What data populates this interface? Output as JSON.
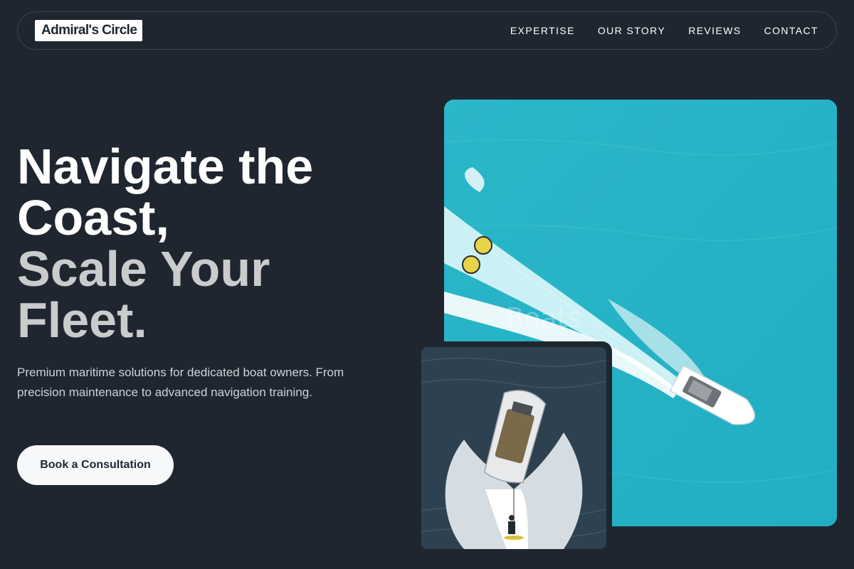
{
  "brand": {
    "logo_text": "Admiral's Circle"
  },
  "nav": {
    "items": [
      {
        "label": "EXPERTISE"
      },
      {
        "label": "OUR STORY"
      },
      {
        "label": "REVIEWS"
      },
      {
        "label": "CONTACT"
      }
    ]
  },
  "hero": {
    "headline_line1": "Navigate the Coast,",
    "headline_line2": "Scale Your Fleet.",
    "subtext": "Premium maritime solutions for dedicated boat owners. From precision maintenance to advanced navigation training.",
    "cta_label": "Book a Consultation",
    "watermark": "Boats"
  },
  "colors": {
    "background": "#1f2630",
    "sea_turquoise": "#28b6c9",
    "sea_dark": "#2c3e4c",
    "headline_muted": "#c9cbcd"
  }
}
